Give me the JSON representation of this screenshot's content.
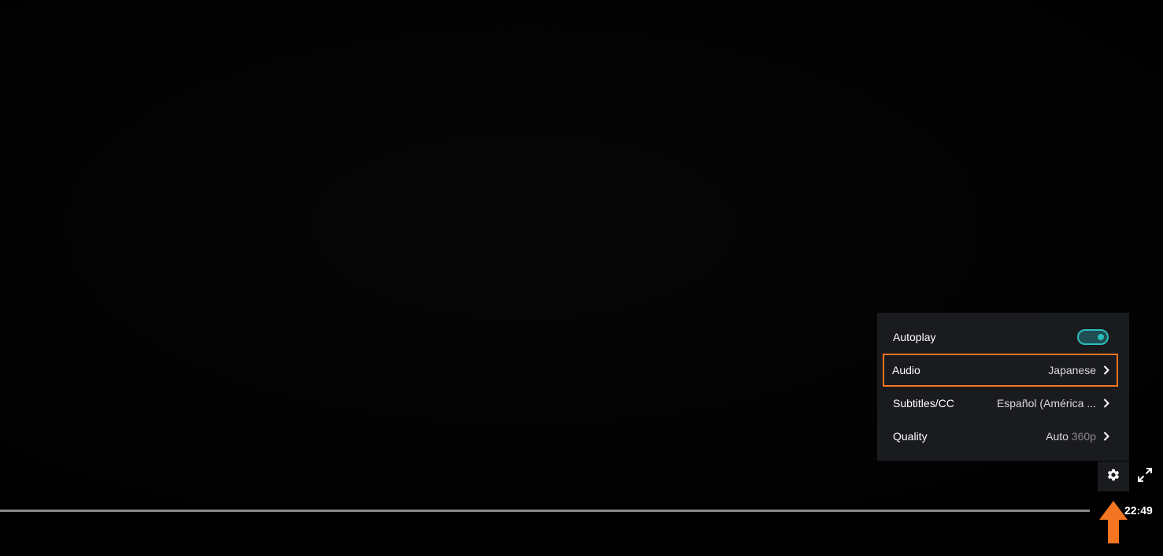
{
  "settings_menu": {
    "rows": [
      {
        "label": "Autoplay",
        "toggle_on": true
      },
      {
        "label": "Audio",
        "value": "Japanese"
      },
      {
        "label": "Subtitles/CC",
        "value": "Español (América ..."
      },
      {
        "label": "Quality",
        "value": "Auto",
        "value_secondary": "360p"
      }
    ],
    "highlighted_row": "Audio"
  },
  "controls": {
    "time_remaining": "22:49",
    "settings_icon": "gear-icon",
    "fullscreen_icon": "expand-icon"
  },
  "colors": {
    "accent": "#2abdbb",
    "highlight_outline": "#f47521",
    "annotation_arrow": "#f47521",
    "menu_background": "#1a1b1e"
  }
}
